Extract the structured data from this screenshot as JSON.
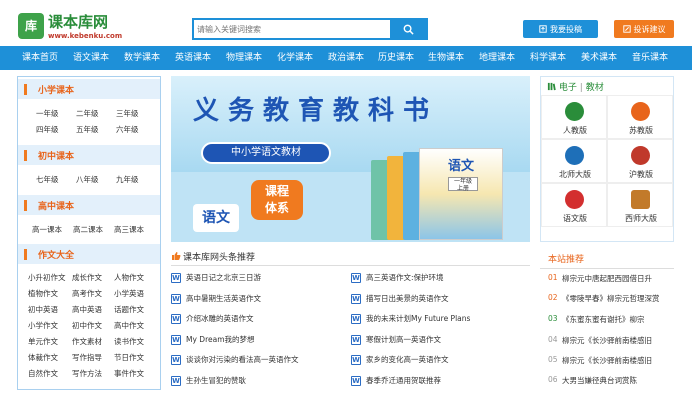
{
  "header": {
    "logo_badge": "库",
    "logo_title": "课本库网",
    "logo_url": "www.kebenku.com",
    "search_placeholder": "请输入关键词搜索",
    "contribute_label": "我要投稿",
    "complaint_label": "投诉建议"
  },
  "nav": {
    "items": [
      "课本首页",
      "语文课本",
      "数学课本",
      "英语课本",
      "物理课本",
      "化学课本",
      "政治课本",
      "历史课本",
      "生物课本",
      "地理课本",
      "科学课本",
      "美术课本",
      "音乐课本"
    ]
  },
  "sidebar": {
    "sections": [
      {
        "title": "小学课本",
        "items": [
          "一年级",
          "二年级",
          "三年级",
          "四年级",
          "五年级",
          "六年级"
        ]
      },
      {
        "title": "初中课本",
        "items": [
          "七年级",
          "八年级",
          "九年级"
        ]
      },
      {
        "title": "高中课本",
        "items": [
          "高一课本",
          "高二课本",
          "高三课本"
        ]
      },
      {
        "title": "作文大全",
        "items": [
          "小升初作文",
          "成长作文",
          "人物作文",
          "植物作文",
          "高考作文",
          "小学英语",
          "初中英语",
          "高中英语",
          "话题作文",
          "小学作文",
          "初中作文",
          "高中作文",
          "单元作文",
          "作文素材",
          "读书作文",
          "体裁作文",
          "写作指导",
          "节日作文",
          "自然作文",
          "写作方法",
          "事件作文"
        ]
      }
    ]
  },
  "banner": {
    "title": "义务教育教科书",
    "pill": "中小学语文教材",
    "badge_line1": "课程",
    "badge_line2": "体系",
    "yuwen_small": "语文",
    "book_title": "语文",
    "book_grade_line1": "一年级",
    "book_grade_line2": "上册"
  },
  "news": {
    "title": "课本库网头条推荐",
    "icon_letter": "W",
    "left": [
      "英语日记之北京三日游",
      "高中暑期生活英语作文",
      "介绍冰雕的英语作文",
      "My Dream我的梦想",
      "谈谈你对污染的看法高一英语作文",
      "生孙生冒犯的赞耿"
    ],
    "right": [
      "高三英语作文:保护环境",
      "描写日出美景的英语作文",
      "我的未来计划My Future Plans",
      "寒假计划高一英语作文",
      "家乡的变化高一英语作文",
      "春季乔迁通用贺联推荐"
    ]
  },
  "publishers": {
    "title_a": "电子",
    "title_sep": "|",
    "title_b": "教材",
    "items": [
      {
        "label": "人教版",
        "color": "#2a8d3a"
      },
      {
        "label": "苏教版",
        "color": "#e8641b"
      },
      {
        "label": "北师大版",
        "color": "#1e6fb8"
      },
      {
        "label": "沪教版",
        "color": "#c0392b"
      },
      {
        "label": "语文版",
        "color": "#d32f2f"
      },
      {
        "label": "西师大版",
        "color": "#c27a2a"
      }
    ]
  },
  "recommend": {
    "title": "本站推荐",
    "items": [
      {
        "n": "01",
        "text": "柳宗元中唐起肥西园借日升"
      },
      {
        "n": "02",
        "text": "《零陵早春》柳宗元哲理深赏"
      },
      {
        "n": "03",
        "text": "《东蜜东蜜有谢托》柳宗"
      },
      {
        "n": "04",
        "text": "柳宗元《长沙驿前南楼感旧"
      },
      {
        "n": "05",
        "text": "柳宗元《长沙驿前南楼感旧"
      },
      {
        "n": "06",
        "text": "大男当嫌径典台词赏陈"
      }
    ]
  }
}
